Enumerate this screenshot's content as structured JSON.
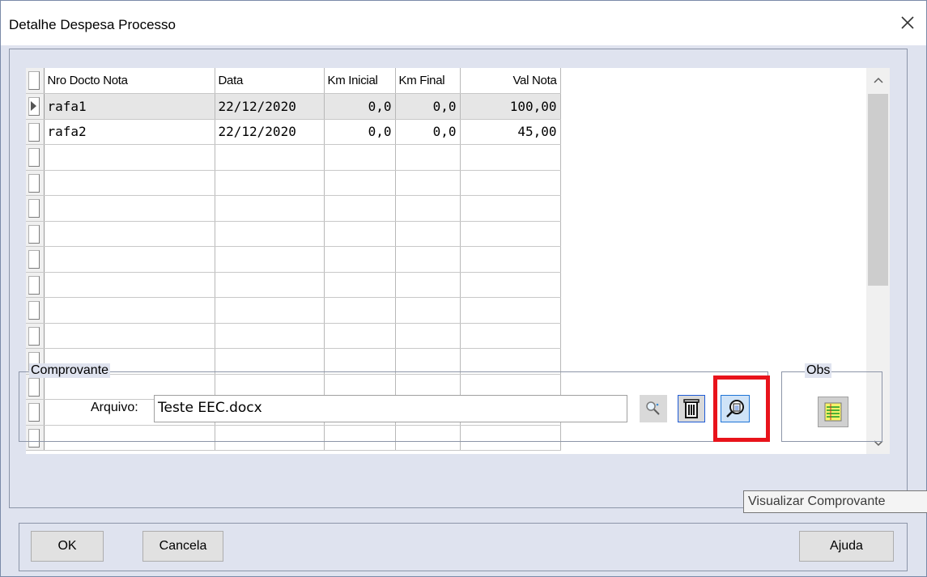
{
  "window": {
    "title": "Detalhe Despesa Processo"
  },
  "grid": {
    "columns": [
      "Nro Docto Nota",
      "Data",
      "Km Inicial",
      "Km Final",
      "Val Nota"
    ],
    "rows": [
      [
        "rafa1",
        "22/12/2020",
        "0,0",
        "0,0",
        "100,00"
      ],
      [
        "rafa2",
        "22/12/2020",
        "0,0",
        "0,0",
        "45,00"
      ],
      [
        "",
        "",
        "",
        "",
        ""
      ],
      [
        "",
        "",
        "",
        "",
        ""
      ],
      [
        "",
        "",
        "",
        "",
        ""
      ],
      [
        "",
        "",
        "",
        "",
        ""
      ],
      [
        "",
        "",
        "",
        "",
        ""
      ],
      [
        "",
        "",
        "",
        "",
        ""
      ],
      [
        "",
        "",
        "",
        "",
        ""
      ],
      [
        "",
        "",
        "",
        "",
        ""
      ],
      [
        "",
        "",
        "",
        "",
        ""
      ],
      [
        "",
        "",
        "",
        "",
        ""
      ],
      [
        "",
        "",
        "",
        "",
        ""
      ],
      [
        "",
        "",
        "",
        "",
        ""
      ]
    ]
  },
  "comprovante": {
    "legend": "Comprovante",
    "arquivo_label": "Arquivo:",
    "arquivo_value": "Teste EEC.docx",
    "search_icon": "magnifier-icon",
    "delete_icon": "trash-icon",
    "view_icon": "view-document-icon"
  },
  "obs": {
    "legend": "Obs",
    "icon": "notes-icon"
  },
  "tooltip": {
    "text": "Visualizar Comprovante"
  },
  "buttons": {
    "ok": "OK",
    "cancela": "Cancela",
    "ajuda": "Ajuda"
  },
  "colors": {
    "highlight": "#e8131b",
    "dialog_bg": "#dfe3ef"
  }
}
